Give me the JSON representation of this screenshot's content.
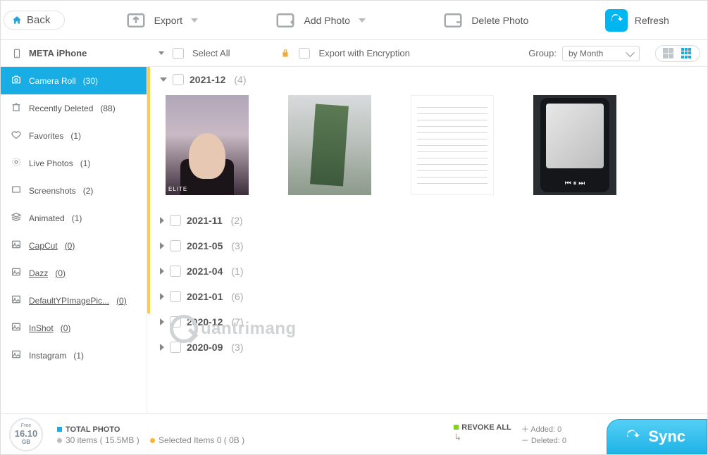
{
  "topbar": {
    "back": "Back",
    "export": "Export",
    "add_photo": "Add Photo",
    "delete_photo": "Delete Photo",
    "refresh": "Refresh"
  },
  "device": {
    "name": "META iPhone"
  },
  "secondbar": {
    "select_all": "Select All",
    "export_encrypted": "Export with Encryption",
    "group_label": "Group:",
    "group_value": "by Month"
  },
  "sidebar": [
    {
      "label": "Camera Roll",
      "count": "(30)",
      "icon": "camera",
      "active": true
    },
    {
      "label": "Recently Deleted",
      "count": "(88)",
      "icon": "trash"
    },
    {
      "label": "Favorites",
      "count": "(1)",
      "icon": "heart"
    },
    {
      "label": "Live Photos",
      "count": "(1)",
      "icon": "live"
    },
    {
      "label": "Screenshots",
      "count": "(2)",
      "icon": "rect"
    },
    {
      "label": "Animated",
      "count": "(1)",
      "icon": "stack"
    },
    {
      "label": "CapCut",
      "count": "(0)",
      "icon": "img",
      "ul": true
    },
    {
      "label": "Dazz",
      "count": "(0)",
      "icon": "img",
      "ul": true
    },
    {
      "label": "DefaultYPImagePic...",
      "count": "(0)",
      "icon": "img",
      "ul": true
    },
    {
      "label": "InShot",
      "count": "(0)",
      "icon": "img",
      "ul": true
    },
    {
      "label": "Instagram",
      "count": "(1)",
      "icon": "img"
    }
  ],
  "groups": [
    {
      "name": "2021-12",
      "count": "(4)",
      "expanded": true,
      "thumbs": 4
    },
    {
      "name": "2021-11",
      "count": "(2)"
    },
    {
      "name": "2021-05",
      "count": "(3)"
    },
    {
      "name": "2021-04",
      "count": "(1)"
    },
    {
      "name": "2021-01",
      "count": "(6)"
    },
    {
      "name": "2020-12",
      "count": "(7)"
    },
    {
      "name": "2020-09",
      "count": "(3)"
    }
  ],
  "watermark": "uantrimang",
  "storage": {
    "free_label": "Free",
    "value": "16.10",
    "unit": "GB"
  },
  "stats": {
    "total_label": "TOTAL PHOTO",
    "items_line": "30 items ( 15.5MB )",
    "selected_line": "Selected Items 0 ( 0B )"
  },
  "revoke": {
    "title": "REVOKE ALL",
    "added": "Added: 0",
    "deleted": "Deleted: 0"
  },
  "sync_label": "Sync"
}
